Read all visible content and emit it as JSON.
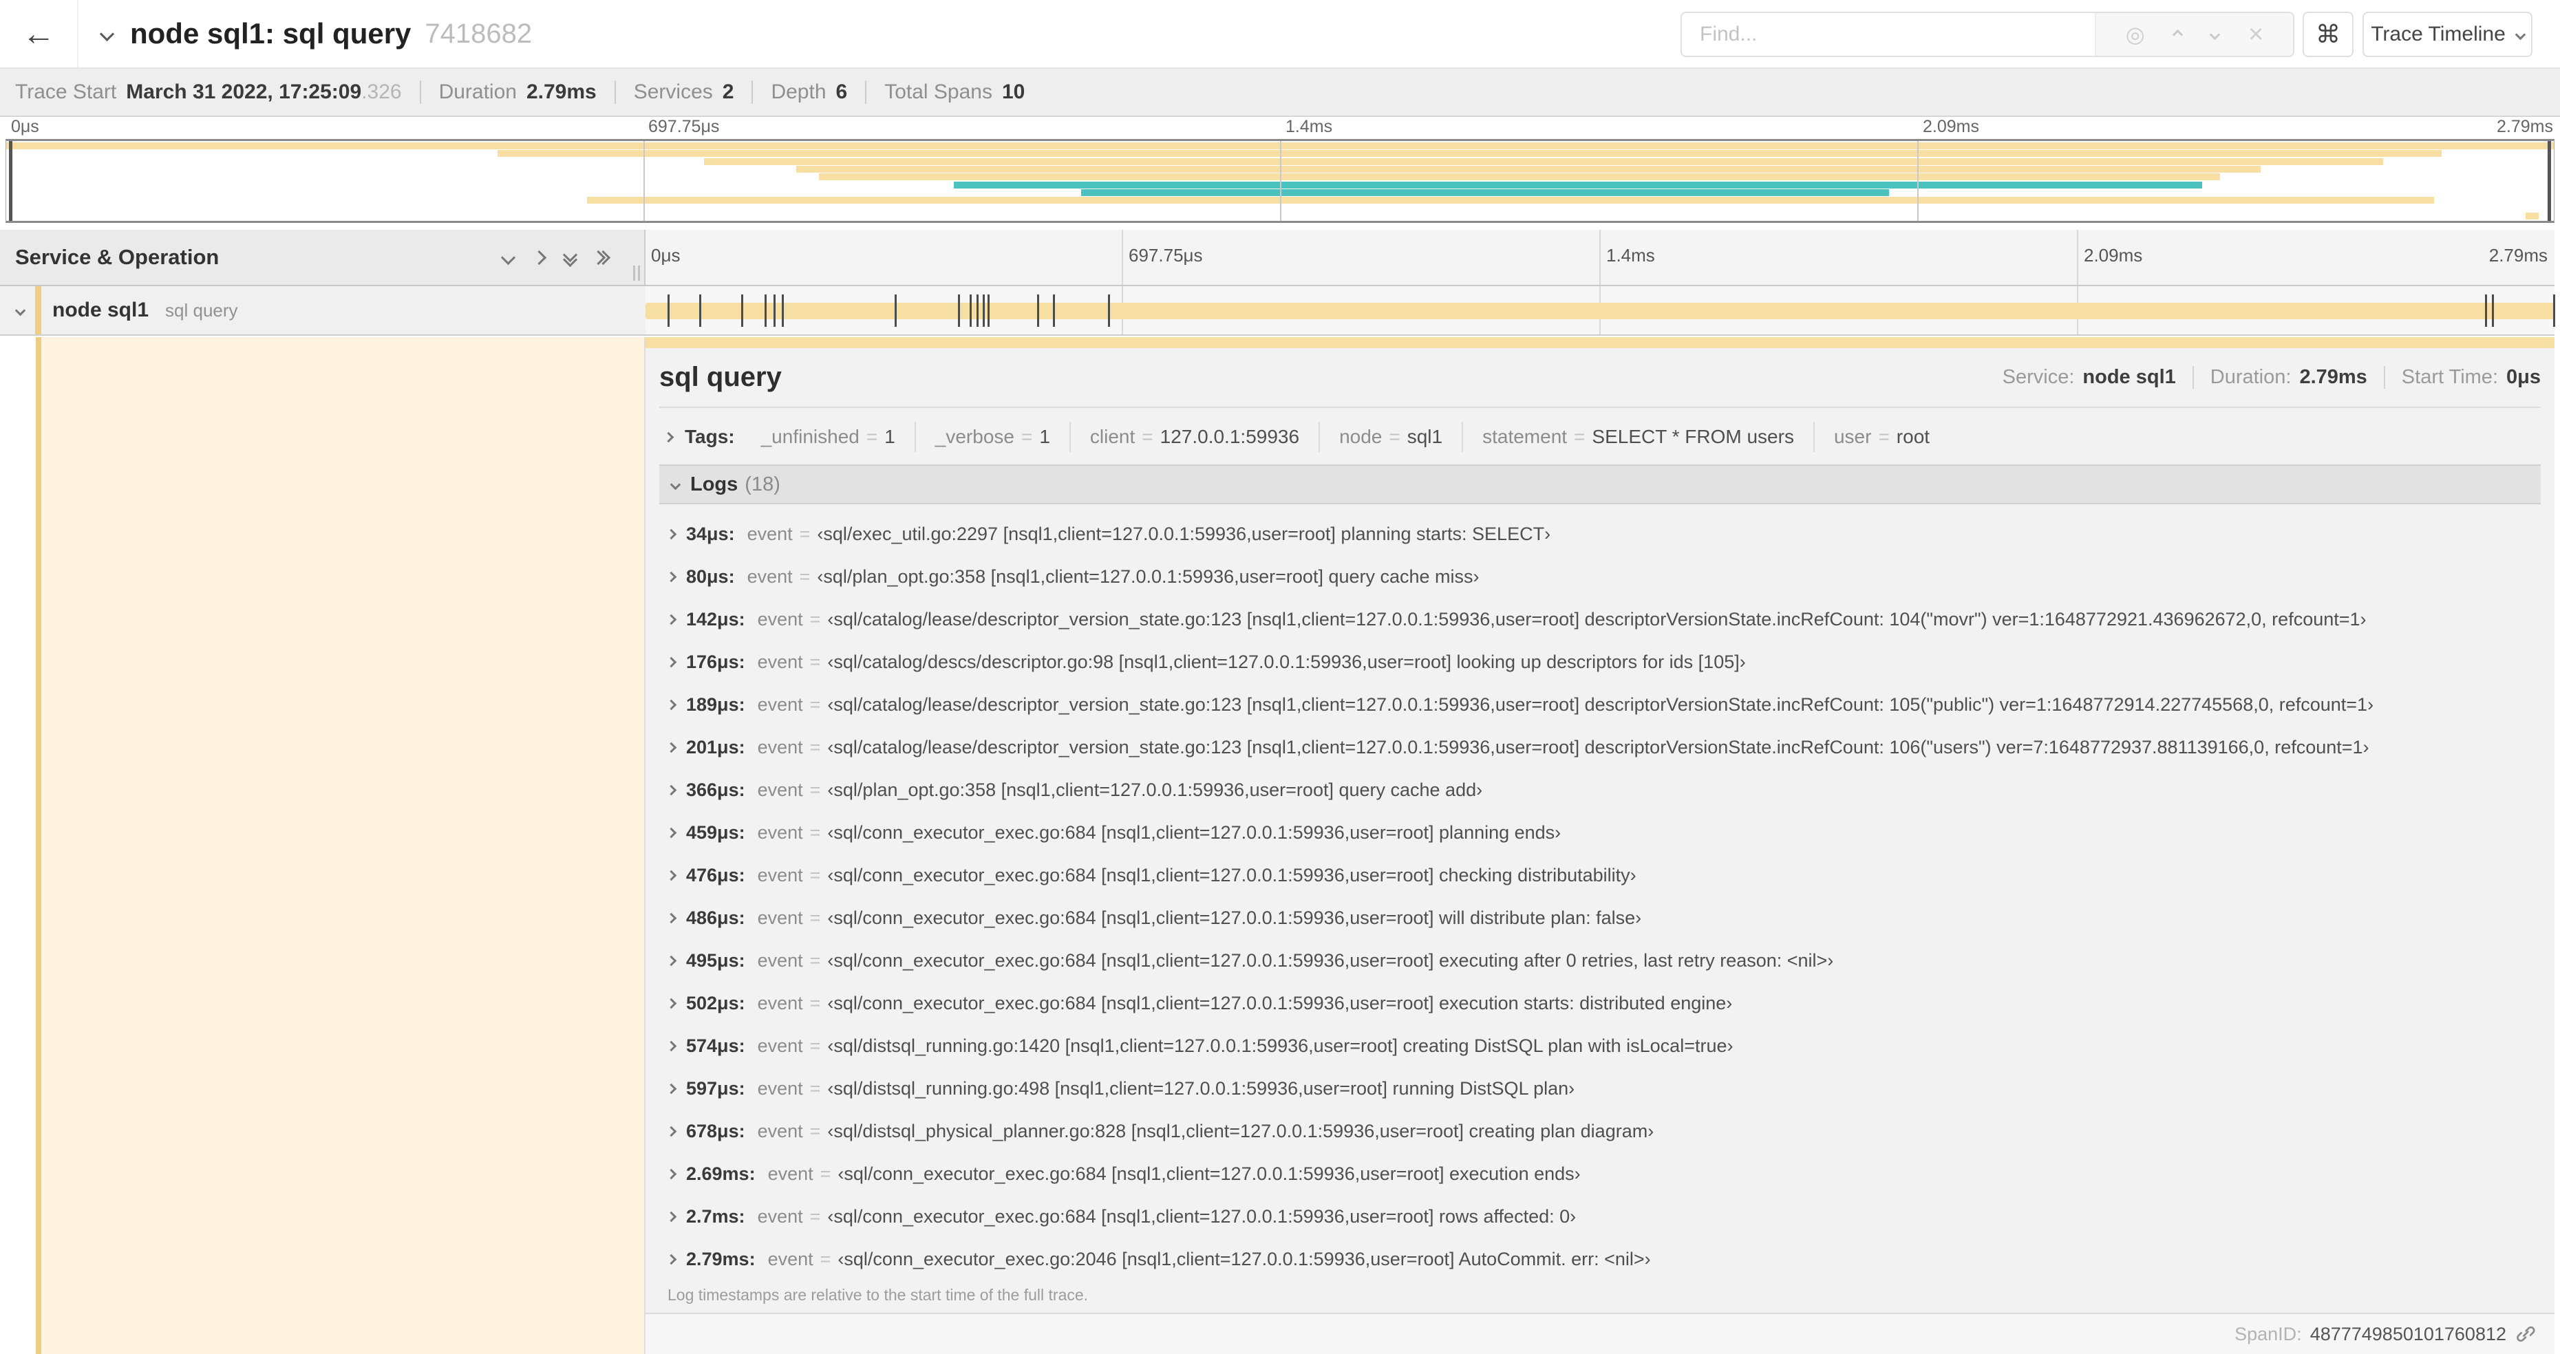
{
  "colors": {
    "span_tan": "#f7dfa4",
    "span_teal": "#4bc2be",
    "detail_accent": "#f0cd85",
    "detail_row_bg": "#fdf3df"
  },
  "top_bar": {
    "back_icon": "←",
    "title": "node sql1: sql query",
    "trace_id": "7418682",
    "find_placeholder": "Find...",
    "target_icon": "◎",
    "clear_icon": "×",
    "cmd_symbol": "⌘",
    "view_selector": "Trace Timeline"
  },
  "summary": {
    "items": [
      {
        "label": "Trace Start",
        "value": "March 31 2022, 17:25:09",
        "suffix": ".326"
      },
      {
        "label": "Duration",
        "value": "2.79ms"
      },
      {
        "label": "Services",
        "value": "2"
      },
      {
        "label": "Depth",
        "value": "6"
      },
      {
        "label": "Total Spans",
        "value": "10"
      }
    ]
  },
  "minimap": {
    "labels": [
      "0μs",
      "697.75μs",
      "1.4ms",
      "2.09ms",
      "2.79ms"
    ],
    "gridlines": [
      0.25,
      0.5,
      0.75
    ],
    "rows": [
      {
        "start": 0.0,
        "end": 1.0,
        "color": "span_tan"
      },
      {
        "start": 0.193,
        "end": 0.956,
        "color": "span_tan"
      },
      {
        "start": 0.274,
        "end": 0.933,
        "color": "span_tan"
      },
      {
        "start": 0.31,
        "end": 0.885,
        "color": "span_tan"
      },
      {
        "start": 0.319,
        "end": 0.869,
        "color": "span_tan"
      },
      {
        "start": 0.372,
        "end": 0.862,
        "color": "span_teal"
      },
      {
        "start": 0.422,
        "end": 0.739,
        "color": "span_teal"
      },
      {
        "start": 0.228,
        "end": 0.953,
        "color": "span_tan"
      },
      {
        "start": 0.0,
        "end": 0.0,
        "color": "span_tan"
      },
      {
        "start": 0.989,
        "end": 0.994,
        "color": "span_tan"
      }
    ]
  },
  "timeline": {
    "header_title": "Service & Operation",
    "ruler_labels": [
      "0μs",
      "697.75μs",
      "1.4ms",
      "2.09ms",
      "2.79ms"
    ]
  },
  "span_row": {
    "service": "node sql1",
    "operation": "sql query",
    "duration_us": 2790,
    "log_marker_times_us": [
      34,
      80,
      142,
      176,
      189,
      201,
      366,
      459,
      476,
      486,
      495,
      502,
      574,
      597,
      678,
      2690,
      2700,
      2790
    ]
  },
  "detail": {
    "title": "sql query",
    "meta": [
      {
        "label": "Service:",
        "value": "node sql1"
      },
      {
        "label": "Duration:",
        "value": "2.79ms"
      },
      {
        "label": "Start Time:",
        "value": "0μs"
      }
    ],
    "tags_label": "Tags:",
    "tags": [
      {
        "key": "_unfinished",
        "value": "1"
      },
      {
        "key": "_verbose",
        "value": "1"
      },
      {
        "key": "client",
        "value": "127.0.0.1:59936"
      },
      {
        "key": "node",
        "value": "sql1"
      },
      {
        "key": "statement",
        "value": "SELECT * FROM users"
      },
      {
        "key": "user",
        "value": "root"
      }
    ],
    "logs": {
      "label": "Logs",
      "count": "(18)",
      "rows": [
        {
          "time": "34μs:",
          "key": "event",
          "value": "‹sql/exec_util.go:2297 [nsql1,client=127.0.0.1:59936,user=root] planning starts: SELECT›"
        },
        {
          "time": "80μs:",
          "key": "event",
          "value": "‹sql/plan_opt.go:358 [nsql1,client=127.0.0.1:59936,user=root] query cache miss›"
        },
        {
          "time": "142μs:",
          "key": "event",
          "value": "‹sql/catalog/lease/descriptor_version_state.go:123 [nsql1,client=127.0.0.1:59936,user=root] descriptorVersionState.incRefCount: 104(\"movr\") ver=1:1648772921.436962672,0, refcount=1›"
        },
        {
          "time": "176μs:",
          "key": "event",
          "value": "‹sql/catalog/descs/descriptor.go:98 [nsql1,client=127.0.0.1:59936,user=root] looking up descriptors for ids [105]›"
        },
        {
          "time": "189μs:",
          "key": "event",
          "value": "‹sql/catalog/lease/descriptor_version_state.go:123 [nsql1,client=127.0.0.1:59936,user=root] descriptorVersionState.incRefCount: 105(\"public\") ver=1:1648772914.227745568,0, refcount=1›"
        },
        {
          "time": "201μs:",
          "key": "event",
          "value": "‹sql/catalog/lease/descriptor_version_state.go:123 [nsql1,client=127.0.0.1:59936,user=root] descriptorVersionState.incRefCount: 106(\"users\") ver=7:1648772937.881139166,0, refcount=1›"
        },
        {
          "time": "366μs:",
          "key": "event",
          "value": "‹sql/plan_opt.go:358 [nsql1,client=127.0.0.1:59936,user=root] query cache add›"
        },
        {
          "time": "459μs:",
          "key": "event",
          "value": "‹sql/conn_executor_exec.go:684 [nsql1,client=127.0.0.1:59936,user=root] planning ends›"
        },
        {
          "time": "476μs:",
          "key": "event",
          "value": "‹sql/conn_executor_exec.go:684 [nsql1,client=127.0.0.1:59936,user=root] checking distributability›"
        },
        {
          "time": "486μs:",
          "key": "event",
          "value": "‹sql/conn_executor_exec.go:684 [nsql1,client=127.0.0.1:59936,user=root] will distribute plan: false›"
        },
        {
          "time": "495μs:",
          "key": "event",
          "value": "‹sql/conn_executor_exec.go:684 [nsql1,client=127.0.0.1:59936,user=root] executing after 0 retries, last retry reason: <nil>›"
        },
        {
          "time": "502μs:",
          "key": "event",
          "value": "‹sql/conn_executor_exec.go:684 [nsql1,client=127.0.0.1:59936,user=root] execution starts: distributed engine›"
        },
        {
          "time": "574μs:",
          "key": "event",
          "value": "‹sql/distsql_running.go:1420 [nsql1,client=127.0.0.1:59936,user=root] creating DistSQL plan with isLocal=true›"
        },
        {
          "time": "597μs:",
          "key": "event",
          "value": "‹sql/distsql_running.go:498 [nsql1,client=127.0.0.1:59936,user=root] running DistSQL plan›"
        },
        {
          "time": "678μs:",
          "key": "event",
          "value": "‹sql/distsql_physical_planner.go:828 [nsql1,client=127.0.0.1:59936,user=root] creating plan diagram›"
        },
        {
          "time": "2.69ms:",
          "key": "event",
          "value": "‹sql/conn_executor_exec.go:684 [nsql1,client=127.0.0.1:59936,user=root] execution ends›"
        },
        {
          "time": "2.7ms:",
          "key": "event",
          "value": "‹sql/conn_executor_exec.go:684 [nsql1,client=127.0.0.1:59936,user=root] rows affected: 0›"
        },
        {
          "time": "2.79ms:",
          "key": "event",
          "value": "‹sql/conn_executor_exec.go:2046 [nsql1,client=127.0.0.1:59936,user=root] AutoCommit. err: <nil>›"
        }
      ]
    },
    "note": "Log timestamps are relative to the start time of the full trace.",
    "span_id_label": "SpanID:",
    "span_id": "4877749850101760812"
  }
}
